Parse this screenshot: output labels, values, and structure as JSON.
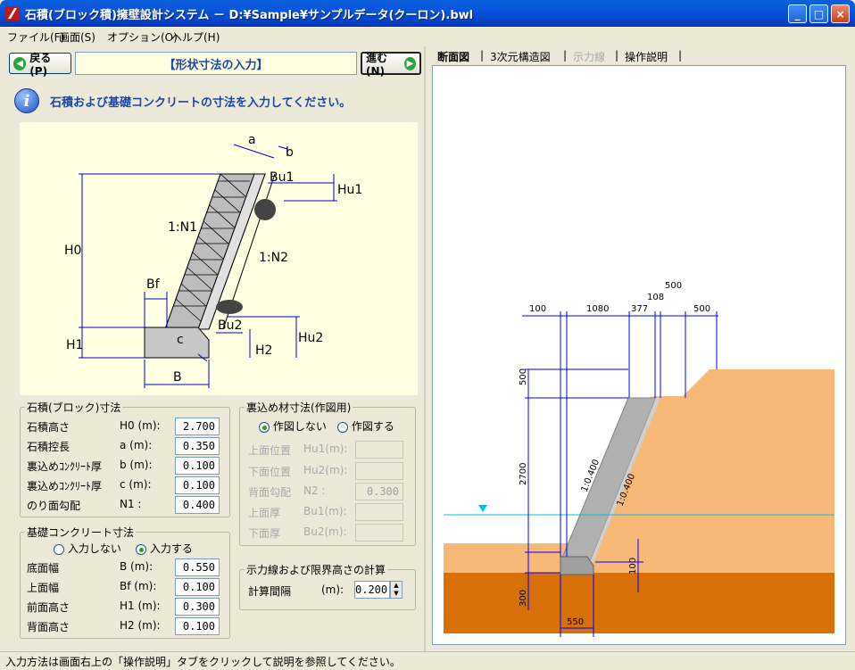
{
  "window": {
    "title": "石積(ブロック積)擁壁設計システム － D:¥Sample¥サンプルデータ(クーロン).bwl",
    "minimize_glyph": "_",
    "maximize_glyph": "□",
    "close_glyph": "×"
  },
  "menu": [
    "ファイル(F)",
    "画面(S)",
    "オプション(O)",
    "ヘルプ(H)"
  ],
  "nav": {
    "back_label": "戻る(P)",
    "header_title": "【形状寸法の入力】",
    "next_label": "進む(N)",
    "instruction": "石積および基礎コンクリートの寸法を入力してください。"
  },
  "diagram": {
    "labels": {
      "a": "a",
      "b": "b",
      "Bu1": "Bu1",
      "Hu1": "Hu1",
      "H0": "H0",
      "N1": "1:N1",
      "N2": "1:N2",
      "Bf": "Bf",
      "Bu2": "Bu2",
      "Hu2": "Hu2",
      "H1": "H1",
      "H2": "H2",
      "c": "c",
      "B": "B"
    }
  },
  "stone_group": {
    "title": "石積(ブロック)寸法",
    "rows": [
      {
        "label": "石積高さ",
        "symbol": "H0 (m):",
        "value": "2.700"
      },
      {
        "label": "石積控長",
        "symbol": "a  (m):",
        "value": "0.350"
      },
      {
        "label": "裏込めｺﾝｸﾘｰﾄ厚",
        "symbol": "b  (m):",
        "value": "0.100"
      },
      {
        "label": "裏込めｺﾝｸﾘｰﾄ厚",
        "symbol": "c  (m):",
        "value": "0.100"
      },
      {
        "label": "のり面勾配",
        "symbol": "N1      :",
        "value": "0.400"
      }
    ]
  },
  "backfill_group": {
    "title": "裏込め材寸法(作図用)",
    "radio_no": "作図しない",
    "radio_yes": "作図する",
    "rows": [
      {
        "label": "上面位置",
        "symbol": "Hu1(m):",
        "value": ""
      },
      {
        "label": "下面位置",
        "symbol": "Hu2(m):",
        "value": ""
      },
      {
        "label": "背面勾配",
        "symbol": "N2     :",
        "value": "0.300"
      },
      {
        "label": "上面厚",
        "symbol": "Bu1(m):",
        "value": ""
      },
      {
        "label": "下面厚",
        "symbol": "Bu2(m):",
        "value": ""
      }
    ]
  },
  "foundation_group": {
    "title": "基礎コンクリート寸法",
    "radio_no": "入力しない",
    "radio_yes": "入力する",
    "rows": [
      {
        "label": "底面幅",
        "symbol": "B  (m):",
        "value": "0.550"
      },
      {
        "label": "上面幅",
        "symbol": "Bf (m):",
        "value": "0.100"
      },
      {
        "label": "前面高さ",
        "symbol": "H1 (m):",
        "value": "0.300"
      },
      {
        "label": "背面高さ",
        "symbol": "H2 (m):",
        "value": "0.100"
      }
    ]
  },
  "calc_group": {
    "title": "示力線および限界高さの計算",
    "label": "計算間隔",
    "unit": "(m):",
    "value": "0.200"
  },
  "tabs": [
    "断面図",
    "3次元構造図",
    "示力線",
    "操作説明"
  ],
  "section": {
    "dims": {
      "d100": "100",
      "d1080": "1080",
      "d377": "377",
      "d108": "108",
      "d500a": "500",
      "d500b": "500",
      "d500v": "500",
      "d2700": "2700",
      "d300": "300",
      "d100v": "100",
      "d550": "550",
      "slope1": "1:0.400",
      "slope2": "1:0.400"
    },
    "colors": {
      "soil_upper": "#f8b878",
      "soil_lower": "#d87008",
      "wall": "#b0b0b0",
      "water": "#00c0e0",
      "dim_line": "#0000ff"
    }
  },
  "status": "入力方法は画面右上の「操作説明」タブをクリックして説明を参照してください。"
}
